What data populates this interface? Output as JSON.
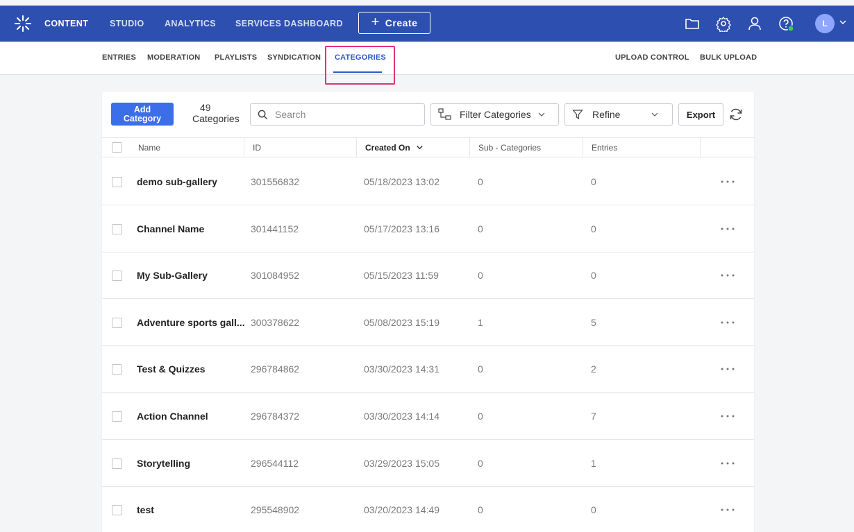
{
  "topnav": {
    "items": [
      {
        "label": "CONTENT",
        "active": true
      },
      {
        "label": "STUDIO",
        "active": false
      },
      {
        "label": "ANALYTICS",
        "active": false
      },
      {
        "label": "SERVICES DASHBOARD",
        "active": false
      }
    ],
    "create_label": "Create",
    "avatar_initial": "L",
    "icons": [
      "folder-icon",
      "gear-icon",
      "user-icon",
      "help-icon"
    ]
  },
  "subnav": {
    "left": [
      "ENTRIES",
      "MODERATION",
      "PLAYLISTS",
      "SYNDICATION",
      "CATEGORIES"
    ],
    "active": "CATEGORIES",
    "right": [
      "UPLOAD CONTROL",
      "BULK UPLOAD"
    ]
  },
  "toolbar": {
    "add_label_1": "Add",
    "add_label_2": "Category",
    "count": "49",
    "count_label": "Categories",
    "search_placeholder": "Search",
    "filter_label": "Filter Categories",
    "refine_label": "Refine",
    "export_label": "Export"
  },
  "table": {
    "columns": [
      "Name",
      "ID",
      "Created On",
      "Sub - Categories",
      "Entries"
    ],
    "sort_column": "Created On",
    "rows": [
      {
        "name": "demo sub-gallery",
        "id": "301556832",
        "created": "05/18/2023 13:02",
        "sub": "0",
        "entries": "0"
      },
      {
        "name": "Channel Name",
        "id": "301441152",
        "created": "05/17/2023 13:16",
        "sub": "0",
        "entries": "0"
      },
      {
        "name": "My Sub-Gallery",
        "id": "301084952",
        "created": "05/15/2023 11:59",
        "sub": "0",
        "entries": "0"
      },
      {
        "name": "Adventure sports gall...",
        "id": "300378622",
        "created": "05/08/2023 15:19",
        "sub": "1",
        "entries": "5"
      },
      {
        "name": "Test & Quizzes",
        "id": "296784862",
        "created": "03/30/2023 14:31",
        "sub": "0",
        "entries": "2"
      },
      {
        "name": "Action Channel",
        "id": "296784372",
        "created": "03/30/2023 14:14",
        "sub": "0",
        "entries": "7"
      },
      {
        "name": "Storytelling",
        "id": "296544112",
        "created": "03/29/2023 15:05",
        "sub": "0",
        "entries": "1"
      },
      {
        "name": "test",
        "id": "295548902",
        "created": "03/20/2023 14:49",
        "sub": "0",
        "entries": "0"
      }
    ]
  },
  "colors": {
    "topbar": "#2d4fb0",
    "accent": "#3b6ee8",
    "active_tab": "#2f57c6",
    "highlight": "#e0307a"
  }
}
